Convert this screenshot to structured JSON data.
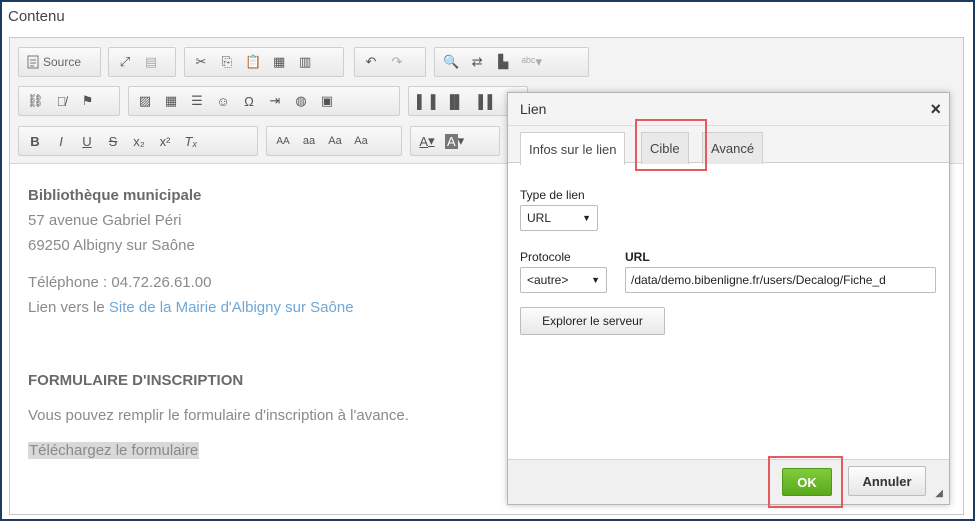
{
  "section_title": "Contenu",
  "toolbar": {
    "source_label": "Source",
    "row1": [
      "fullscreen-icon",
      "preview-icon",
      "cut-icon",
      "copy-icon",
      "paste-icon",
      "paste-text-icon",
      "paste-word-icon",
      "undo-icon",
      "redo-icon",
      "find-icon",
      "replace-icon",
      "select-all-icon",
      "spellcheck-icon"
    ],
    "row2": [
      "link-icon",
      "unlink-icon",
      "anchor-icon",
      "image-icon",
      "table-icon",
      "horizontal-rule-icon",
      "smiley-icon",
      "special-char-icon",
      "page-break-icon",
      "iframe-icon",
      "video-icon",
      "align-left-icon",
      "align-center-icon",
      "align-right-icon"
    ],
    "row3": {
      "bold": "B",
      "italic": "I",
      "underline": "U",
      "strike": "S",
      "subscript": "x₂",
      "superscript": "x²",
      "remove_format": "Tₓ",
      "upper": "AA",
      "lower": "aa",
      "title": "Aa",
      "toggle": "Aa",
      "text_color": "A",
      "bg_color": "A"
    }
  },
  "content": {
    "org_name": "Bibliothèque municipale",
    "address1": "57 avenue Gabriel Péri",
    "address2": "69250 Albigny sur Saône",
    "phone": "Téléphone : 04.72.26.61.00",
    "link_prefix": "Lien vers le ",
    "link_text": "Site de la Mairie d'Albigny sur Saône",
    "form_heading": "FORMULAIRE D'INSCRIPTION",
    "form_desc": "Vous pouvez remplir le formulaire d'inscription à l'avance.",
    "download_text": "Téléchargez le formulaire"
  },
  "dialog": {
    "title": "Lien",
    "close": "×",
    "tabs": [
      {
        "label": "Infos sur le lien",
        "active": true
      },
      {
        "label": "Cible",
        "active": false,
        "highlighted": true
      },
      {
        "label": "Avancé",
        "active": false
      }
    ],
    "link_type_label": "Type de lien",
    "link_type_value": "URL",
    "protocol_label": "Protocole",
    "protocol_value": "<autre>",
    "url_label": "URL",
    "url_value": "/data/demo.bibenligne.fr/users/Decalog/Fiche_d",
    "browse_button": "Explorer le serveur",
    "ok_button": "OK",
    "cancel_button": "Annuler"
  },
  "colors": {
    "highlight_border": "#e8585f",
    "ok_green": "#62b022",
    "link_blue": "#6fa7d6"
  }
}
